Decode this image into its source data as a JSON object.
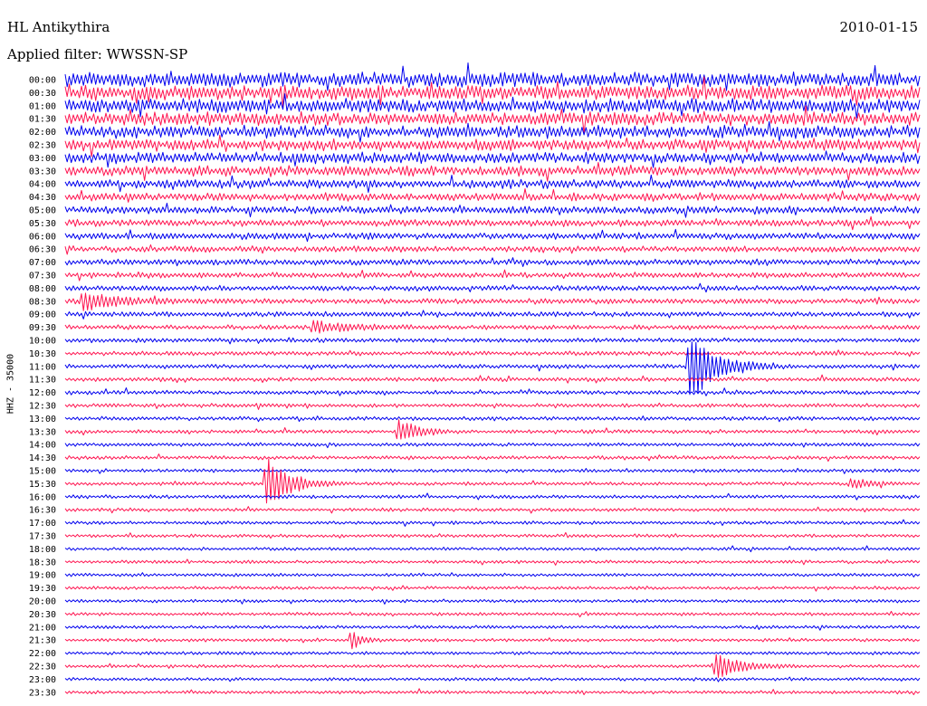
{
  "header": {
    "station": "HL Antikythira",
    "date": "2010-01-15",
    "filter": "Applied filter: WWSSN-SP"
  },
  "chart_data": {
    "type": "line",
    "title": "HL Antikythira",
    "ylabel": "HHZ - 35000",
    "row_labels": [
      "00:00",
      "00:30",
      "01:00",
      "01:30",
      "02:00",
      "02:30",
      "03:00",
      "03:30",
      "04:00",
      "04:30",
      "05:00",
      "05:30",
      "06:00",
      "06:30",
      "07:00",
      "07:30",
      "08:00",
      "08:30",
      "09:00",
      "09:30",
      "10:00",
      "10:30",
      "11:00",
      "11:30",
      "12:00",
      "12:30",
      "13:00",
      "13:30",
      "14:00",
      "14:30",
      "15:00",
      "15:30",
      "16:00",
      "16:30",
      "17:00",
      "17:30",
      "18:00",
      "18:30",
      "19:00",
      "19:30",
      "20:00",
      "20:30",
      "21:00",
      "21:30",
      "22:00",
      "22:30",
      "23:00",
      "23:30"
    ],
    "trace_colors": [
      "#0000ee",
      "#ff1450"
    ],
    "noise_amplitude": [
      1.0,
      1.0,
      0.95,
      0.9,
      0.85,
      0.8,
      0.75,
      0.7,
      0.6,
      0.55,
      0.5,
      0.48,
      0.45,
      0.42,
      0.4,
      0.38,
      0.36,
      0.36,
      0.34,
      0.32,
      0.3,
      0.3,
      0.28,
      0.28,
      0.27,
      0.27,
      0.26,
      0.25,
      0.25,
      0.25,
      0.24,
      0.24,
      0.24,
      0.23,
      0.23,
      0.22,
      0.22,
      0.22,
      0.22,
      0.22,
      0.22,
      0.22,
      0.22,
      0.22,
      0.22,
      0.22,
      0.22,
      0.22
    ],
    "events": [
      {
        "row": 17,
        "x": 0.02,
        "amp": 1.0,
        "width": 0.04
      },
      {
        "row": 19,
        "x": 0.29,
        "amp": 0.6,
        "width": 0.035
      },
      {
        "row": 22,
        "x": 0.73,
        "amp": 4.0,
        "width": 0.03
      },
      {
        "row": 27,
        "x": 0.39,
        "amp": 1.5,
        "width": 0.02
      },
      {
        "row": 31,
        "x": 0.235,
        "amp": 3.0,
        "width": 0.025
      },
      {
        "row": 31,
        "x": 0.92,
        "amp": 0.6,
        "width": 0.02
      },
      {
        "row": 43,
        "x": 0.335,
        "amp": 1.2,
        "width": 0.01
      },
      {
        "row": 45,
        "x": 0.76,
        "amp": 1.4,
        "width": 0.03
      }
    ],
    "xlim": [
      0,
      30
    ],
    "grid": false
  }
}
